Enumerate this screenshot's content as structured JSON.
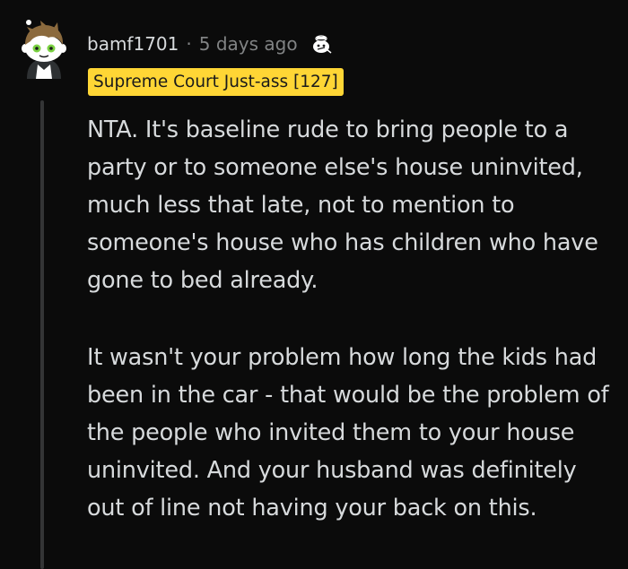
{
  "comment": {
    "username": "bamf1701",
    "separator": "·",
    "timestamp": "5 days ago",
    "flair": "Supreme Court Just-ass [127]",
    "award_icon": "snoo-award-icon",
    "avatar_icon": "reddit-snoo-avatar",
    "paragraphs": [
      "NTA. It's baseline rude to bring people to a party or to someone else's house uninvited, much less that late, not to mention to someone's house who has children who have gone to bed already.",
      "It wasn't your problem how long the kids had been in the car - that would be the problem of the people who invited them to your house uninvited. And your husband was definitely out of line not having your back on this."
    ]
  },
  "colors": {
    "background": "#0b0b0b",
    "text": "#d7dadc",
    "meta": "#818384",
    "flair_bg": "#ffd635",
    "thread_line": "#343536"
  }
}
